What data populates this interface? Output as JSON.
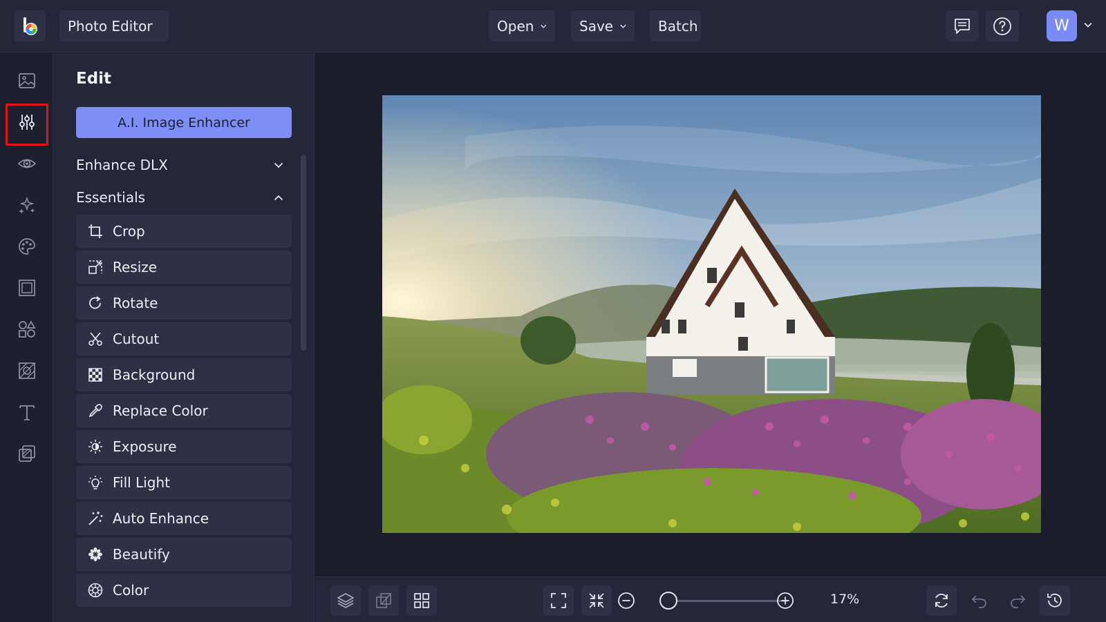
{
  "header": {
    "app_menu_label": "Photo Editor",
    "open_label": "Open",
    "save_label": "Save",
    "batch_label": "Batch",
    "user_initial": "W"
  },
  "rail": {
    "items": [
      "image-icon",
      "sliders-icon",
      "eye-icon",
      "sparkles-icon",
      "palette-icon",
      "frame-icon",
      "shapes-icon",
      "texture-icon",
      "text-icon",
      "overlay-icon"
    ],
    "active": "sliders-icon"
  },
  "panel": {
    "title": "Edit",
    "ai_button": "A.I. Image Enhancer",
    "sections": {
      "enhance": "Enhance DLX",
      "essentials": "Essentials"
    },
    "tools": [
      {
        "label": "Crop",
        "icon": "crop-icon"
      },
      {
        "label": "Resize",
        "icon": "resize-icon"
      },
      {
        "label": "Rotate",
        "icon": "rotate-icon"
      },
      {
        "label": "Cutout",
        "icon": "scissors-icon"
      },
      {
        "label": "Background",
        "icon": "checker-icon"
      },
      {
        "label": "Replace Color",
        "icon": "eyedropper-icon"
      },
      {
        "label": "Exposure",
        "icon": "sun-icon"
      },
      {
        "label": "Fill Light",
        "icon": "bulb-icon"
      },
      {
        "label": "Auto Enhance",
        "icon": "magic-wand-icon"
      },
      {
        "label": "Beautify",
        "icon": "flower-icon"
      },
      {
        "label": "Color",
        "icon": "color-wheel-icon"
      }
    ]
  },
  "footer": {
    "zoom": "17%",
    "zoom_value": 0.17
  },
  "colors": {
    "accent": "#7f8df7",
    "active_highlight": "#e0141c",
    "background": "#1b1d2a",
    "panel": "#24273a"
  }
}
